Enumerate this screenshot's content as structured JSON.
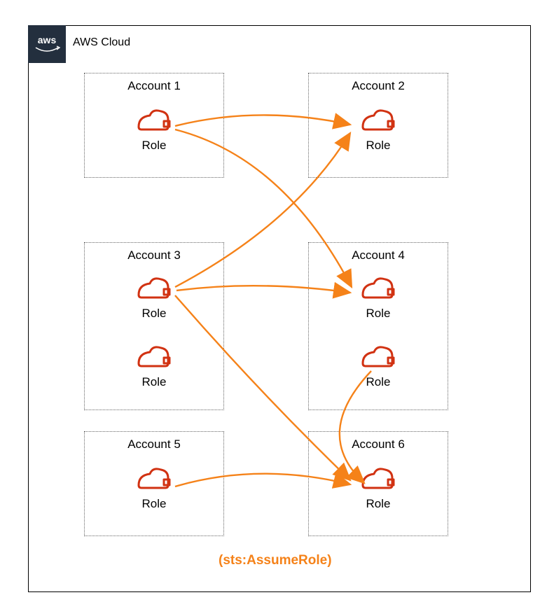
{
  "cloud": {
    "title": "AWS Cloud",
    "logo_text": "aws"
  },
  "accounts": {
    "a1": {
      "title": "Account 1",
      "roles": [
        "Role"
      ]
    },
    "a2": {
      "title": "Account 2",
      "roles": [
        "Role"
      ]
    },
    "a3": {
      "title": "Account 3",
      "roles": [
        "Role",
        "Role"
      ]
    },
    "a4": {
      "title": "Account 4",
      "roles": [
        "Role",
        "Role"
      ]
    },
    "a5": {
      "title": "Account 5",
      "roles": [
        "Role"
      ]
    },
    "a6": {
      "title": "Account 6",
      "roles": [
        "Role"
      ]
    }
  },
  "footer": "(sts:AssumeRole)",
  "edges_description": "Orange arrows depict sts:AssumeRole calls: Account1.Role → Account2.Role, Account1.Role → Account4.Role, Account3.Role → Account2.Role, Account3.Role → Account4.Role, Account3.Role → Account6.Role, Account4.Role(second) → Account6.Role, Account5.Role → Account6.Role",
  "colors": {
    "arrow": "#F58219",
    "role_icon": "#D13212",
    "frame": "#000000",
    "dots": "#666666",
    "logo_bg": "#232F3E"
  }
}
